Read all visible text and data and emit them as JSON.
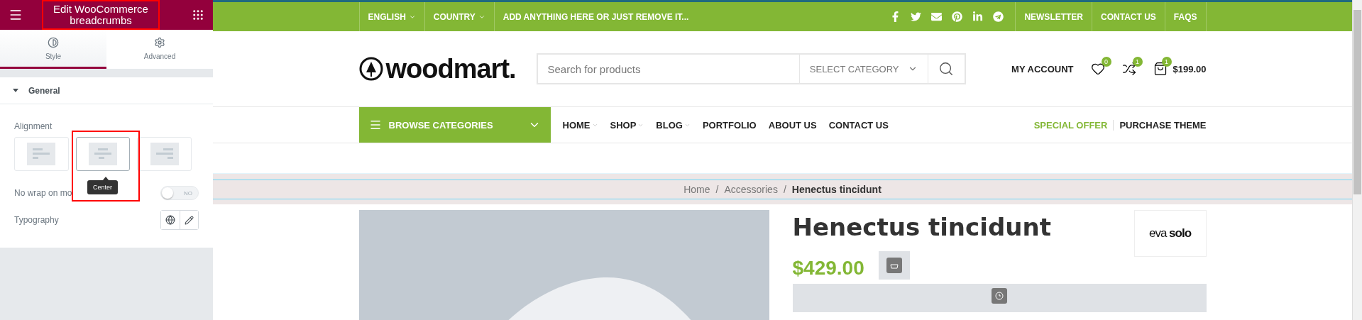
{
  "panel": {
    "title": "Edit WooCommerce breadcrumbs",
    "tabs": [
      {
        "label": "Style",
        "selected": true
      },
      {
        "label": "Advanced",
        "selected": false
      }
    ],
    "section": {
      "title": "General",
      "expanded": true
    },
    "alignment": {
      "label": "Alignment",
      "options": [
        {
          "selected": false
        },
        {
          "selected": true
        },
        {
          "selected": false
        }
      ],
      "tooltip": "Center"
    },
    "nowrap": {
      "label": "No wrap on mo",
      "on": false,
      "state_text": "NO"
    },
    "typography": {
      "label": "Typography"
    }
  },
  "topbar": {
    "language": "ENGLISH",
    "country": "COUNTRY",
    "promo": "ADD ANYTHING HERE OR JUST REMOVE IT...",
    "links": [
      "NEWSLETTER",
      "CONTACT US",
      "FAQS"
    ]
  },
  "header": {
    "logo": "woodmart.",
    "search_placeholder": "Search for products",
    "category": "SELECT CATEGORY",
    "account": "MY ACCOUNT",
    "wishlist_count": "0",
    "compare_count": "1",
    "cart_count": "1",
    "cart_total": "$199.00"
  },
  "nav": {
    "browse": "BROWSE CATEGORIES",
    "items": [
      {
        "label": "HOME",
        "dropdown": true
      },
      {
        "label": "SHOP",
        "dropdown": true
      },
      {
        "label": "BLOG",
        "dropdown": true
      },
      {
        "label": "PORTFOLIO",
        "dropdown": false
      },
      {
        "label": "ABOUT US",
        "dropdown": false
      },
      {
        "label": "CONTACT US",
        "dropdown": false
      }
    ],
    "special": "SPECIAL OFFER",
    "purchase": "PURCHASE THEME"
  },
  "breadcrumbs": {
    "separator": "/",
    "items": [
      {
        "label": "Home",
        "current": false
      },
      {
        "label": "Accessories",
        "current": false
      },
      {
        "label": "Henectus tincidunt",
        "current": true
      }
    ]
  },
  "product": {
    "title": "Henectus tincidunt",
    "price": "$429.00",
    "brand": "eva **solo**"
  }
}
